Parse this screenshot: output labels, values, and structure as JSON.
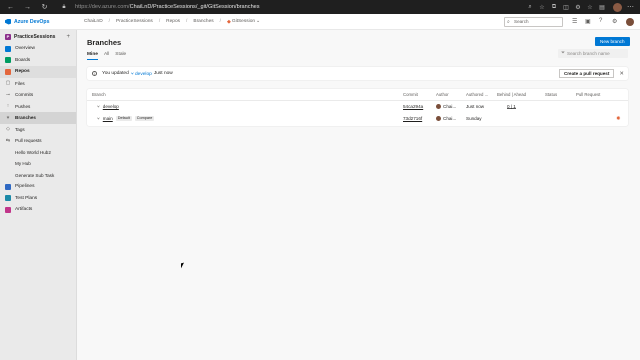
{
  "browser": {
    "url_host": "https://dev.azure.com/",
    "url_path": "ChaiLnD/PracticeSessions/_git/GitSession/branches"
  },
  "header": {
    "brand": "Azure DevOps",
    "breadcrumbs": [
      "ChaiLnD",
      "PracticeSessions",
      "Repos",
      "Branches"
    ],
    "repo": "GitSession",
    "search_placeholder": "Search"
  },
  "sidebar": {
    "project": "PracticeSessions",
    "project_initial": "P",
    "items": [
      {
        "label": "Overview",
        "color": "#0078d4"
      },
      {
        "label": "Boards",
        "color": "#009c61"
      },
      {
        "label": "Repos",
        "color": "#e3663c"
      }
    ],
    "repo_items": [
      "Files",
      "Commits",
      "Pushes",
      "Branches",
      "Tags",
      "Pull requests",
      "Hello World Hub2",
      "My Hub",
      "Generate Sub Task"
    ],
    "bottom_items": [
      {
        "label": "Pipelines",
        "color": "#2f69c3"
      },
      {
        "label": "Test Plans",
        "color": "#1c8aa8"
      },
      {
        "label": "Artifacts",
        "color": "#c1358a"
      }
    ]
  },
  "main": {
    "title": "Branches",
    "new_branch": "New branch",
    "tabs": [
      "Mine",
      "All",
      "Stale"
    ],
    "filter_placeholder": "Search branch name",
    "banner": {
      "prefix": "You updated",
      "branch": "develop",
      "time": "Just now",
      "action": "Create a pull request"
    },
    "columns": [
      "Branch",
      "Commit",
      "Author",
      "Authored ...",
      "Behind | Ahead",
      "Status",
      "Pull Request"
    ],
    "rows": [
      {
        "branch": "develop",
        "tags": [],
        "commit": "54ca294a",
        "author": "Chai...",
        "authored": "Just now",
        "behind_ahead": "0 | 1"
      },
      {
        "branch": "main",
        "tags": [
          "Default",
          "Compare"
        ],
        "commit": "73d2716f",
        "author": "Chai...",
        "authored": "Sunday",
        "behind_ahead": ""
      }
    ]
  }
}
